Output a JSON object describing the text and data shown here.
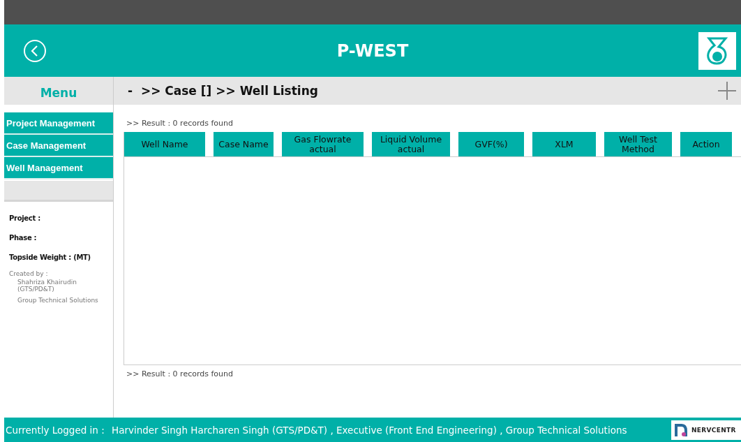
{
  "header": {
    "title": "P-WEST"
  },
  "sidebar": {
    "menu_title": "Menu",
    "items": [
      {
        "label": "Project Management"
      },
      {
        "label": "Case Management"
      },
      {
        "label": "Well Management"
      }
    ],
    "info": [
      {
        "label": "Project :"
      },
      {
        "label": "Phase :"
      },
      {
        "label": "Topside Weight : (MT)"
      }
    ],
    "created_by": {
      "label": "Created by :",
      "name": "Shahriza Khairudin (GTS/PD&T)",
      "department": "Group Technical Solutions"
    }
  },
  "breadcrumb": "-  >> Case [] >> Well Listing",
  "result_top": ">> Result : 0 records found",
  "table": {
    "columns": [
      "Well Name",
      "Case Name",
      "Gas Flowrate actual",
      "Liquid Volume actual",
      "GVF(%)",
      "XLM",
      "Well Test Method",
      "Action"
    ]
  },
  "result_bottom": ">> Result : 0 records found",
  "footer": {
    "label": "Currently Logged in :",
    "user": "Harvinder Singh Harcharen Singh (GTS/PD&T) , Executive (Front End Engineering) , Group Technical Solutions",
    "brand": "NERVCENTR"
  }
}
